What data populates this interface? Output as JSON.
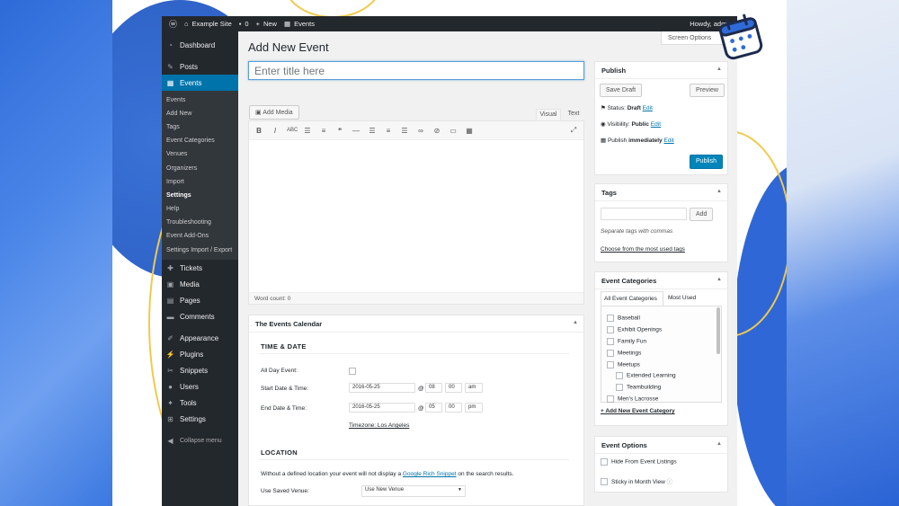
{
  "adminbar": {
    "site_name": "Example Site",
    "comments_count": "0",
    "new_label": "New",
    "events_label": "Events",
    "howdy": "Howdy, admi"
  },
  "sidebar": {
    "dashboard": "Dashboard",
    "posts": "Posts",
    "events": "Events",
    "submenu": [
      "Events",
      "Add New",
      "Tags",
      "Event Categories",
      "Venues",
      "Organizers",
      "Import",
      "Settings",
      "Help",
      "Troubleshooting",
      "Event Add-Ons",
      "Settings Import / Export"
    ],
    "bottom_items": [
      "Tickets",
      "Media",
      "Pages",
      "Comments",
      "Appearance",
      "Plugins",
      "Snippets",
      "Users",
      "Tools",
      "Settings",
      "Collapse menu"
    ]
  },
  "page": {
    "title": "Add New Event",
    "screen_options": "Screen Options",
    "title_placeholder": "Enter title here"
  },
  "editor": {
    "add_media": "Add Media",
    "tab_visual": "Visual",
    "tab_text": "Text",
    "word_count": "Word count: 0"
  },
  "calendar_box": {
    "title": "The Events Calendar",
    "time_date_heading": "TIME & DATE",
    "all_day_label": "All Day Event:",
    "start_label": "Start Date & Time:",
    "start_date": "2016-05-25",
    "start_hour": "08",
    "start_min": "00",
    "start_ampm": "am",
    "end_label": "End Date & Time:",
    "end_date": "2016-05-25",
    "end_hour": "05",
    "end_min": "00",
    "end_ampm": "pm",
    "at": "@",
    "timezone": "Timezone: Los Angeles",
    "location_heading": "LOCATION",
    "location_note_pre": "Without a defined location your event will not display a",
    "location_note_link": "Google Rich Snippet",
    "location_note_post": "on the search results.",
    "venue_label": "Use Saved Venue:",
    "venue_value": "Use New Venue"
  },
  "publish": {
    "title": "Publish",
    "save_draft": "Save Draft",
    "preview": "Preview",
    "status_label": "Status:",
    "status_value": "Draft",
    "visibility_label": "Visibility:",
    "visibility_value": "Public",
    "publish_label": "Publish",
    "publish_value": "immediately",
    "edit": "Edit",
    "publish_button": "Publish"
  },
  "tags": {
    "title": "Tags",
    "add": "Add",
    "hint": "Separate tags with commas",
    "choose": "Choose from the most used tags"
  },
  "categories": {
    "title": "Event Categories",
    "tab_all": "All Event Categories",
    "tab_most": "Most Used",
    "items": [
      "Baseball",
      "Exhibit Openings",
      "Family Fun",
      "Meetings",
      "Meetups"
    ],
    "sub_items": [
      "Extended Learning",
      "Teambuilding"
    ],
    "last_item": "Men's Lacrosse",
    "add_new": "+ Add New Event Category"
  },
  "event_options": {
    "title": "Event Options",
    "hide": "Hide From Event Listings",
    "sticky": "Sticky in Month View"
  }
}
